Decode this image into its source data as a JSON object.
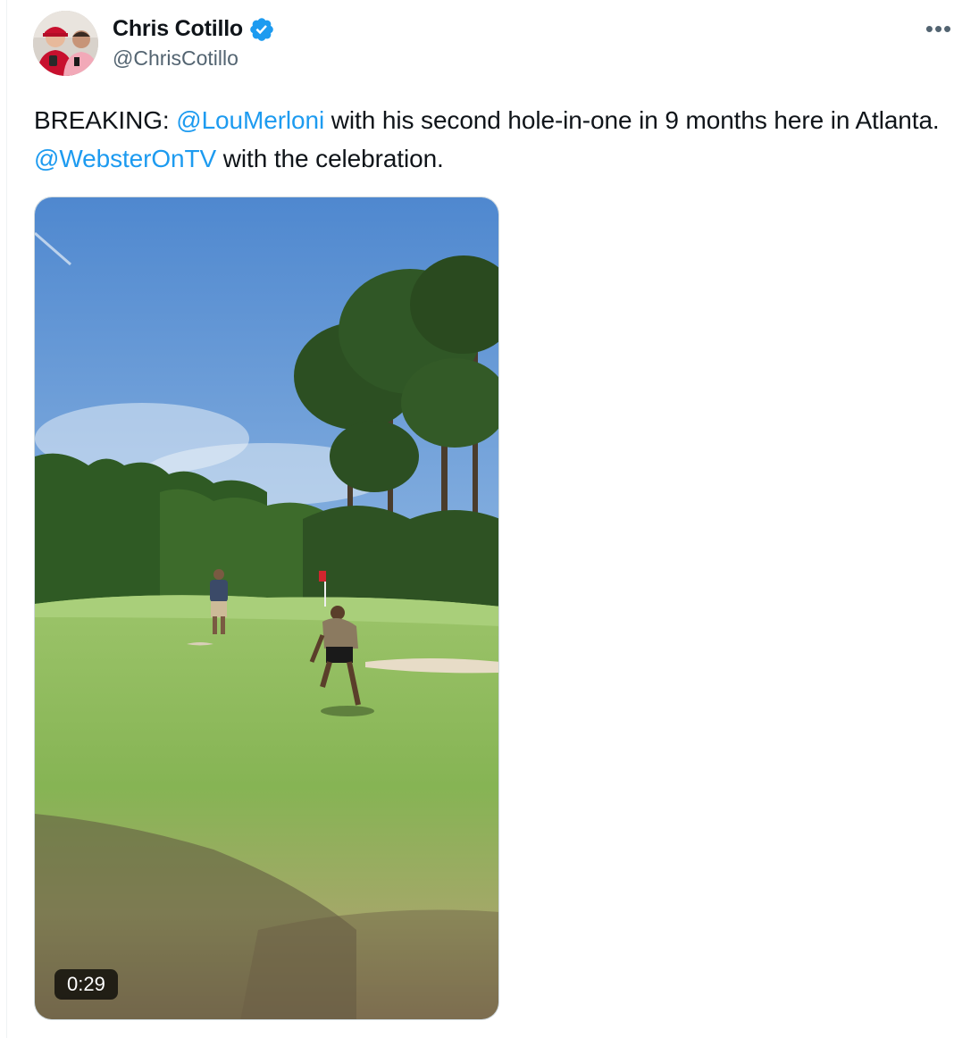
{
  "author": {
    "display_name": "Chris Cotillo",
    "handle": "@ChrisCotillo",
    "verified": true,
    "avatar_icon": "avatar-photo-icon"
  },
  "menu": {
    "more_label": "•••"
  },
  "tweet": {
    "text_prefix": "BREAKING: ",
    "mention_1": "@LouMerloni",
    "text_middle": " with his second hole-in-one in 9 months here in Atlanta. ",
    "mention_2": "@WebsterOnTV",
    "text_suffix": " with the celebration."
  },
  "media": {
    "type": "video",
    "duration": "0:29",
    "thumbnail_icon": "golf-course-video-thumbnail"
  },
  "colors": {
    "link": "#1d9bf0",
    "text": "#0f1419",
    "secondary": "#536471",
    "verified": "#1d9bf0"
  }
}
